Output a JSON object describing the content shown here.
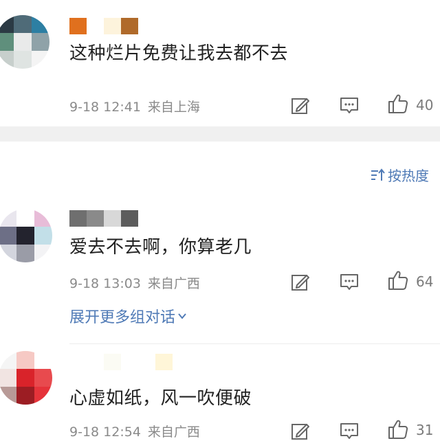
{
  "sort": {
    "label": "按热度"
  },
  "comments": [
    {
      "text": "这种烂片免费让我去都不去",
      "time": "9-18 12:41",
      "location": "来自上海",
      "likes": "40"
    },
    {
      "text": "爱去不去啊，你算老几",
      "time": "9-18 13:03",
      "location": "来自广西",
      "likes": "64",
      "expand": "展开更多组对话"
    },
    {
      "text": "心虚如纸，风一吹便破",
      "time": "9-18 12:54",
      "location": "来自广西",
      "likes": "31"
    }
  ],
  "colors": {
    "accent": "#4f7ab6",
    "meta": "#8a8a8a",
    "divider": "#f0f0f0"
  },
  "icons": [
    "edit-icon",
    "comment-icon",
    "thumbs-up-icon",
    "sort-icon",
    "chevron-down-icon"
  ]
}
